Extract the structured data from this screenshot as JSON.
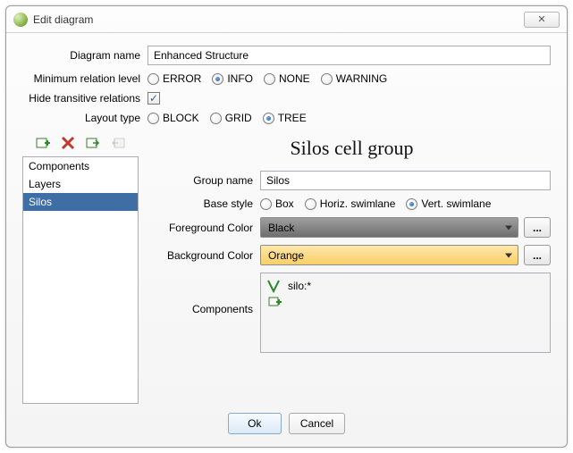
{
  "window": {
    "title": "Edit diagram",
    "close": "✕"
  },
  "top_form": {
    "diagram_name_label": "Diagram name",
    "diagram_name_value": "Enhanced Structure",
    "min_rel_label": "Minimum relation level",
    "min_rel_options": {
      "error": "ERROR",
      "info": "INFO",
      "none": "NONE",
      "warning": "WARNING"
    },
    "min_rel_selected": "info",
    "hide_trans_label": "Hide transitive relations",
    "hide_trans_checked": true,
    "layout_label": "Layout type",
    "layout_options": {
      "block": "BLOCK",
      "grid": "GRID",
      "tree": "TREE"
    },
    "layout_selected": "tree"
  },
  "left": {
    "items": [
      "Components",
      "Layers",
      "Silos"
    ],
    "selected_index": 2
  },
  "right": {
    "heading": "Silos cell group",
    "group_name_label": "Group name",
    "group_name_value": "Silos",
    "base_style_label": "Base style",
    "base_style_options": {
      "box": "Box",
      "hswim": "Horiz. swimlane",
      "vswim": "Vert. swimlane"
    },
    "base_style_selected": "vswim",
    "fg_label": "Foreground Color",
    "fg_value": "Black",
    "bg_label": "Background Color",
    "bg_value": "Orange",
    "components_label": "Components",
    "component_entry": "silo:*",
    "dots": "..."
  },
  "buttons": {
    "ok": "Ok",
    "cancel": "Cancel"
  }
}
